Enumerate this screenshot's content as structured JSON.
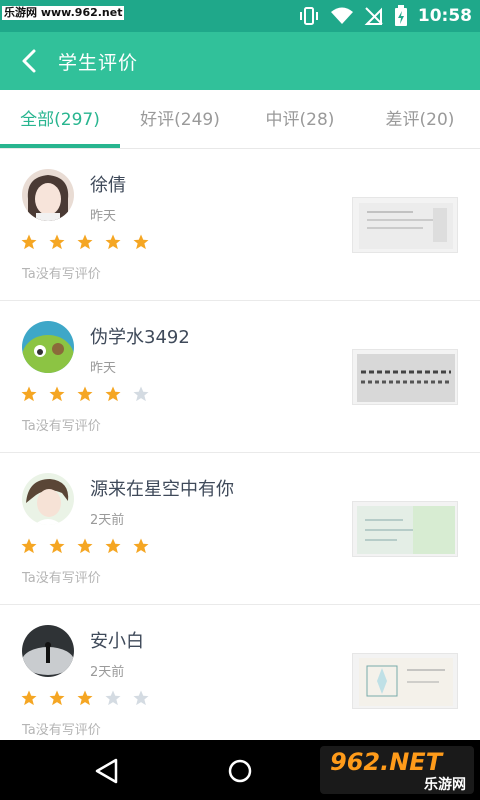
{
  "status_bar": {
    "watermark": "乐游网 www.962.net",
    "time": "10:58"
  },
  "app_bar": {
    "title": "学生评价"
  },
  "tabs": [
    {
      "label": "全部(297)",
      "active": true
    },
    {
      "label": "好评(249)",
      "active": false
    },
    {
      "label": "中评(28)",
      "active": false
    },
    {
      "label": "差评(20)",
      "active": false
    }
  ],
  "reviews": [
    {
      "name": "徐倩",
      "time": "昨天",
      "rating": 5,
      "comment": "Ta没有写评价"
    },
    {
      "name": "伪学水3492",
      "time": "昨天",
      "rating": 4,
      "comment": "Ta没有写评价"
    },
    {
      "name": "源来在星空中有你",
      "time": "2天前",
      "rating": 5,
      "comment": "Ta没有写评价"
    },
    {
      "name": "安小白",
      "time": "2天前",
      "rating": 3,
      "comment": "Ta没有写评价"
    }
  ],
  "nav_logo": {
    "top": "962.NET",
    "bottom": "乐游网"
  },
  "colors": {
    "accent": "#31c19a",
    "status_bar": "#1fa88a",
    "star_on": "#f5a623",
    "star_off": "#d4dbe2"
  }
}
